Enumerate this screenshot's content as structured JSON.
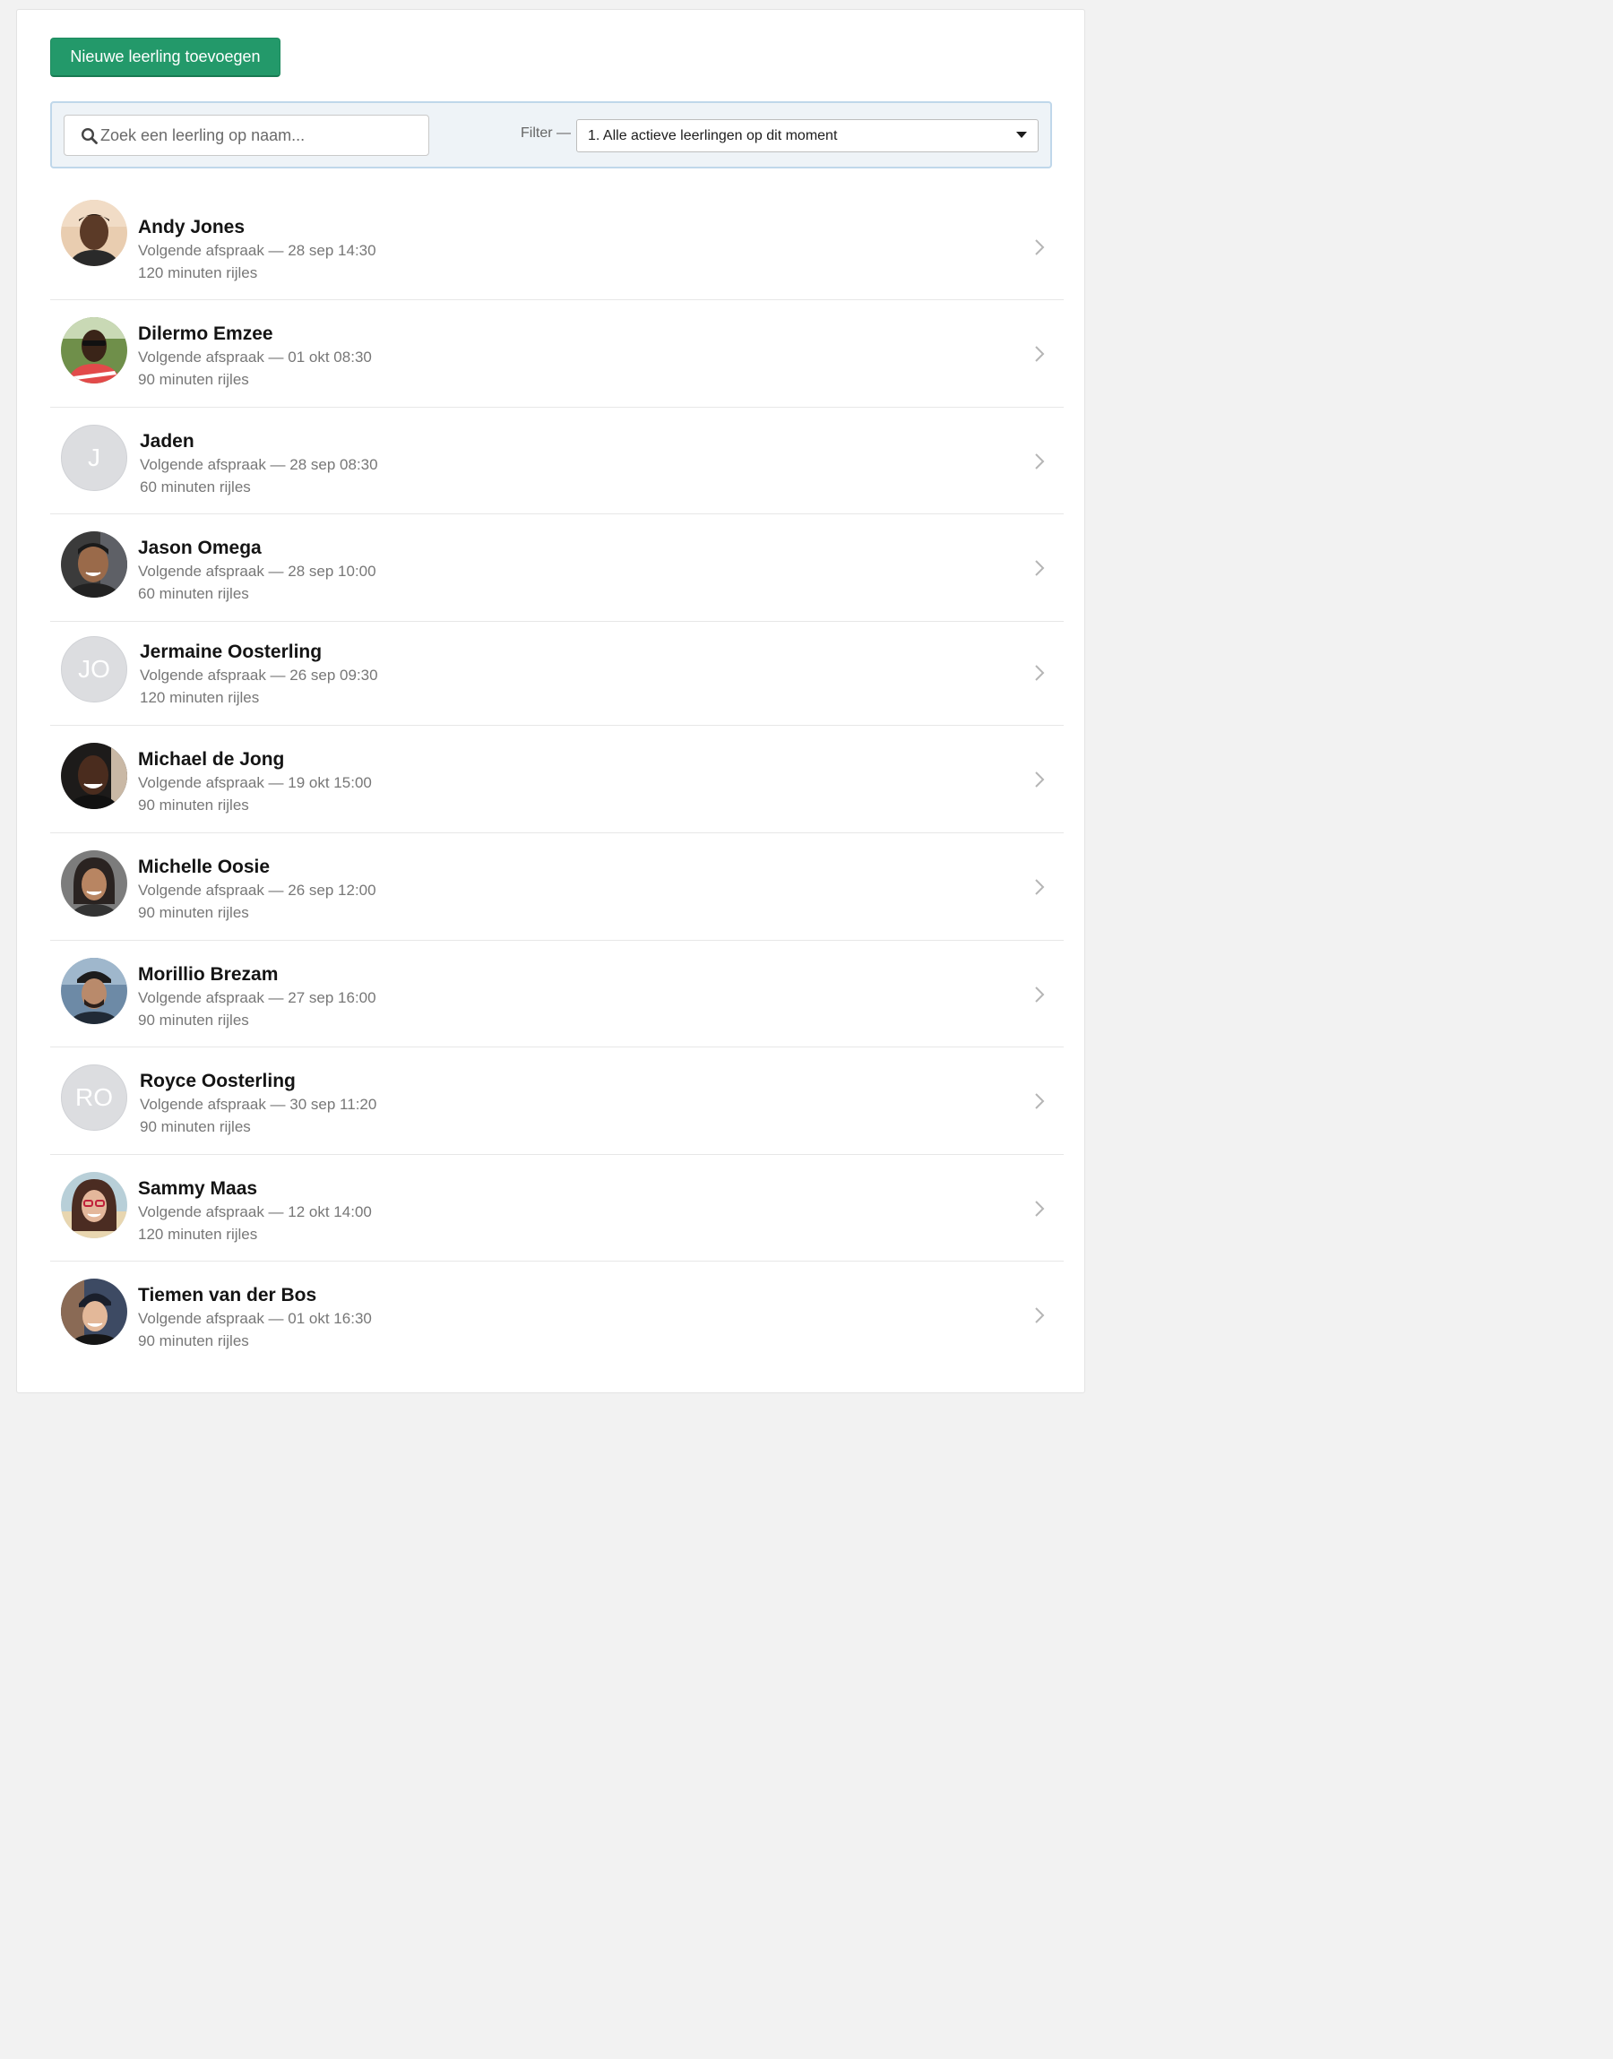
{
  "actions": {
    "add_student_label": "Nieuwe leerling toevoegen"
  },
  "search": {
    "placeholder": "Zoek een leerling op naam..."
  },
  "filter": {
    "label": "Filter —",
    "selected": "1. Alle actieve leerlingen op dit moment"
  },
  "colors": {
    "primary": "#23996a",
    "toolbar_bg": "#eef3f7",
    "toolbar_border": "#bfd7ea",
    "avatar_placeholder": "#dcdde0"
  },
  "students": [
    {
      "name": "Andy Jones",
      "next": "Volgende afspraak — 28 sep 14:30",
      "duration": "120 minuten rijles",
      "avatar": "photo"
    },
    {
      "name": "Dilermo Emzee",
      "next": "Volgende afspraak — 01 okt 08:30",
      "duration": "90 minuten rijles",
      "avatar": "photo"
    },
    {
      "name": "Jaden",
      "next": "Volgende afspraak — 28 sep 08:30",
      "duration": "60 minuten rijles",
      "avatar": "initials",
      "initials": "J"
    },
    {
      "name": "Jason Omega",
      "next": "Volgende afspraak — 28 sep 10:00",
      "duration": "60 minuten rijles",
      "avatar": "photo"
    },
    {
      "name": "Jermaine Oosterling",
      "next": "Volgende afspraak — 26 sep 09:30",
      "duration": "120 minuten rijles",
      "avatar": "initials",
      "initials": "JO"
    },
    {
      "name": "Michael de Jong",
      "next": "Volgende afspraak — 19 okt 15:00",
      "duration": "90 minuten rijles",
      "avatar": "photo"
    },
    {
      "name": "Michelle Oosie",
      "next": "Volgende afspraak — 26 sep 12:00",
      "duration": "90 minuten rijles",
      "avatar": "photo"
    },
    {
      "name": "Morillio Brezam",
      "next": "Volgende afspraak — 27 sep 16:00",
      "duration": "90 minuten rijles",
      "avatar": "photo"
    },
    {
      "name": "Royce Oosterling",
      "next": "Volgende afspraak — 30 sep 11:20",
      "duration": "90 minuten rijles",
      "avatar": "initials",
      "initials": "RO"
    },
    {
      "name": "Sammy Maas",
      "next": "Volgende afspraak — 12 okt 14:00",
      "duration": "120 minuten rijles",
      "avatar": "photo"
    },
    {
      "name": "Tiemen van der Bos",
      "next": "Volgende afspraak — 01 okt 16:30",
      "duration": "90 minuten rijles",
      "avatar": "photo"
    }
  ]
}
